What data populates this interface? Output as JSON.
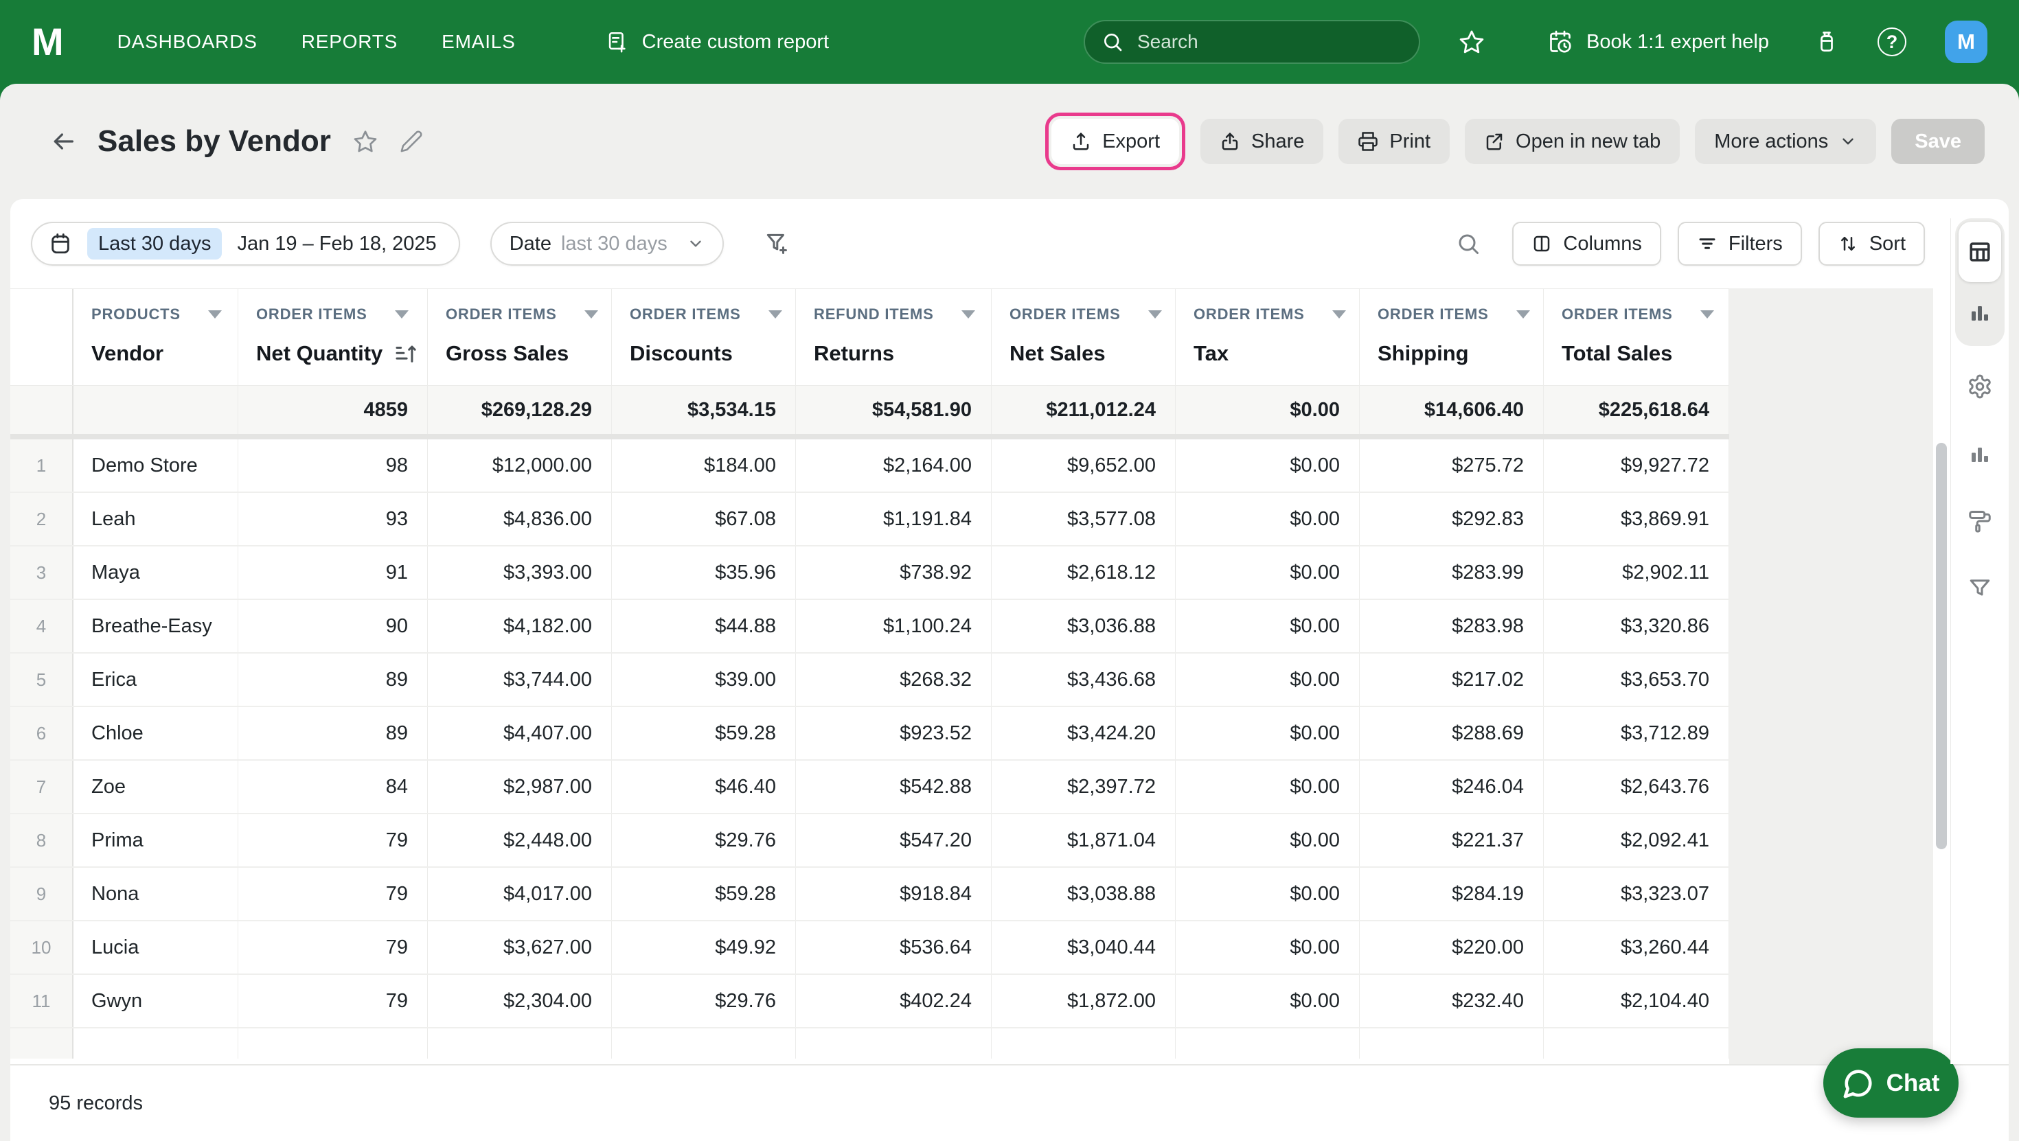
{
  "nav": {
    "logo": "M",
    "items": [
      "DASHBOARDS",
      "REPORTS",
      "EMAILS"
    ],
    "create_report_label": "Create custom report",
    "search_placeholder": "Search",
    "book_help_label": "Book 1:1 expert help",
    "avatar_initial": "M"
  },
  "header": {
    "title": "Sales by Vendor",
    "export_label": "Export",
    "share_label": "Share",
    "print_label": "Print",
    "open_new_tab_label": "Open in new tab",
    "more_actions_label": "More actions",
    "save_label": "Save"
  },
  "toolbar": {
    "date_preset_chip": "Last 30 days",
    "date_range": "Jan 19 – Feb 18, 2025",
    "date_filter_field": "Date",
    "date_filter_value": "last 30 days",
    "columns_label": "Columns",
    "filters_label": "Filters",
    "sort_label": "Sort"
  },
  "table": {
    "columns": [
      {
        "group": "PRODUCTS",
        "name": "Vendor"
      },
      {
        "group": "ORDER ITEMS",
        "name": "Net Quantity",
        "sorted": true
      },
      {
        "group": "ORDER ITEMS",
        "name": "Gross Sales"
      },
      {
        "group": "ORDER ITEMS",
        "name": "Discounts"
      },
      {
        "group": "REFUND ITEMS",
        "name": "Returns"
      },
      {
        "group": "ORDER ITEMS",
        "name": "Net Sales"
      },
      {
        "group": "ORDER ITEMS",
        "name": "Tax"
      },
      {
        "group": "ORDER ITEMS",
        "name": "Shipping"
      },
      {
        "group": "ORDER ITEMS",
        "name": "Total Sales"
      }
    ],
    "totals": [
      "4859",
      "$269,128.29",
      "$3,534.15",
      "$54,581.90",
      "$211,012.24",
      "$0.00",
      "$14,606.40",
      "$225,618.64"
    ],
    "rows": [
      {
        "num": "1",
        "vendor": "Demo Store",
        "values": [
          "98",
          "$12,000.00",
          "$184.00",
          "$2,164.00",
          "$9,652.00",
          "$0.00",
          "$275.72",
          "$9,927.72"
        ]
      },
      {
        "num": "2",
        "vendor": "Leah",
        "values": [
          "93",
          "$4,836.00",
          "$67.08",
          "$1,191.84",
          "$3,577.08",
          "$0.00",
          "$292.83",
          "$3,869.91"
        ]
      },
      {
        "num": "3",
        "vendor": "Maya",
        "values": [
          "91",
          "$3,393.00",
          "$35.96",
          "$738.92",
          "$2,618.12",
          "$0.00",
          "$283.99",
          "$2,902.11"
        ]
      },
      {
        "num": "4",
        "vendor": "Breathe-Easy",
        "values": [
          "90",
          "$4,182.00",
          "$44.88",
          "$1,100.24",
          "$3,036.88",
          "$0.00",
          "$283.98",
          "$3,320.86"
        ]
      },
      {
        "num": "5",
        "vendor": "Erica",
        "values": [
          "89",
          "$3,744.00",
          "$39.00",
          "$268.32",
          "$3,436.68",
          "$0.00",
          "$217.02",
          "$3,653.70"
        ]
      },
      {
        "num": "6",
        "vendor": "Chloe",
        "values": [
          "89",
          "$4,407.00",
          "$59.28",
          "$923.52",
          "$3,424.20",
          "$0.00",
          "$288.69",
          "$3,712.89"
        ]
      },
      {
        "num": "7",
        "vendor": "Zoe",
        "values": [
          "84",
          "$2,987.00",
          "$46.40",
          "$542.88",
          "$2,397.72",
          "$0.00",
          "$246.04",
          "$2,643.76"
        ]
      },
      {
        "num": "8",
        "vendor": "Prima",
        "values": [
          "79",
          "$2,448.00",
          "$29.76",
          "$547.20",
          "$1,871.04",
          "$0.00",
          "$221.37",
          "$2,092.41"
        ]
      },
      {
        "num": "9",
        "vendor": "Nona",
        "values": [
          "79",
          "$4,017.00",
          "$59.28",
          "$918.84",
          "$3,038.88",
          "$0.00",
          "$284.19",
          "$3,323.07"
        ]
      },
      {
        "num": "10",
        "vendor": "Lucia",
        "values": [
          "79",
          "$3,627.00",
          "$49.92",
          "$536.64",
          "$3,040.44",
          "$0.00",
          "$220.00",
          "$3,260.44"
        ]
      },
      {
        "num": "11",
        "vendor": "Gwyn",
        "values": [
          "79",
          "$2,304.00",
          "$29.76",
          "$402.24",
          "$1,872.00",
          "$0.00",
          "$232.40",
          "$2,104.40"
        ]
      }
    ]
  },
  "footer": {
    "records": "95 records"
  },
  "chat": {
    "label": "Chat"
  },
  "colors": {
    "brand_green": "#177c38",
    "highlight_pink": "#e93a8c",
    "chip_blue": "#d4e8fb",
    "avatar_blue": "#41a3ea",
    "page_gray": "#f0f0ee"
  }
}
